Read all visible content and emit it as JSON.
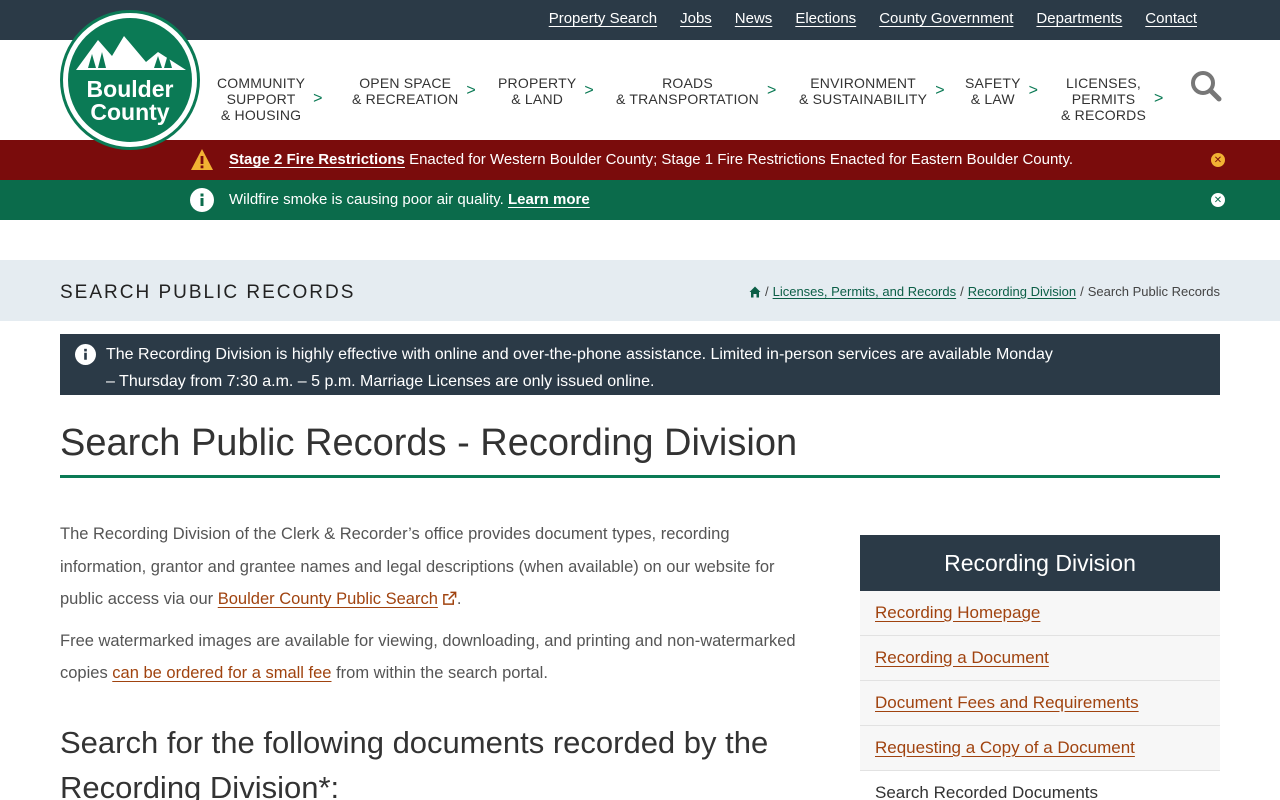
{
  "utility_nav": [
    "Property Search",
    "Jobs",
    "News",
    "Elections",
    "County Government",
    "Departments",
    "Contact"
  ],
  "logo": {
    "line1": "Boulder",
    "line2": "County"
  },
  "main_nav": [
    {
      "lines": [
        "COMMUNITY",
        "SUPPORT",
        "& HOUSING"
      ]
    },
    {
      "lines": [
        "OPEN SPACE",
        "& RECREATION"
      ]
    },
    {
      "lines": [
        "PROPERTY",
        "& LAND"
      ]
    },
    {
      "lines": [
        "ROADS",
        "& TRANSPORTATION"
      ]
    },
    {
      "lines": [
        "ENVIRONMENT",
        "& SUSTAINABILITY"
      ]
    },
    {
      "lines": [
        "SAFETY",
        "& LAW"
      ]
    },
    {
      "lines": [
        "LICENSES,",
        "PERMITS",
        "& RECORDS"
      ]
    }
  ],
  "nav_chevron": ">",
  "alerts": {
    "fire": {
      "link": "Stage 2 Fire Restrictions",
      "text": " Enacted for Western Boulder County; Stage 1 Fire Restrictions Enacted for Eastern Boulder County.",
      "close": "✕"
    },
    "smoke": {
      "text": "Wildfire smoke is causing poor air quality. ",
      "link": "Learn more",
      "close": "✕"
    }
  },
  "page_header": {
    "title": "SEARCH PUBLIC RECORDS"
  },
  "breadcrumb": {
    "sep": "/",
    "items": [
      "Licenses, Permits, and Records",
      "Recording Division"
    ],
    "current": "Search Public Records"
  },
  "info_banner": {
    "text": "The Recording Division is highly effective with online and over-the-phone assistance. Limited in-person services are available Monday – Thursday from 7:30 a.m. – 5 p.m. Marriage Licenses are only issued online."
  },
  "heading": "Search Public Records - Recording Division",
  "body": {
    "p1_before": "The Recording Division of the Clerk & Recorder’s office provides document types, recording information, grantor and grantee names and legal descriptions (when available) on our website for public access via our ",
    "p1_link": "Boulder County Public Search",
    "p1_after": ".",
    "p2_before": "Free watermarked images are available for viewing, downloading, and printing and non-watermarked copies ",
    "p2_link": "can be ordered for a small fee",
    "p2_after": " from within the search portal."
  },
  "subheading": "Search for the following documents recorded by the Recording Division*:",
  "sidebar": {
    "title": "Recording Division",
    "items": [
      "Recording Homepage",
      "Recording a Document",
      "Document Fees and Requirements",
      "Requesting a Copy of a Document"
    ],
    "current": "Search Recorded Documents"
  },
  "colors": {
    "brand_green": "#0b7a55",
    "navy": "#2b3a47",
    "alert_red": "#7a0c0c",
    "link_orange": "#a0430f"
  }
}
